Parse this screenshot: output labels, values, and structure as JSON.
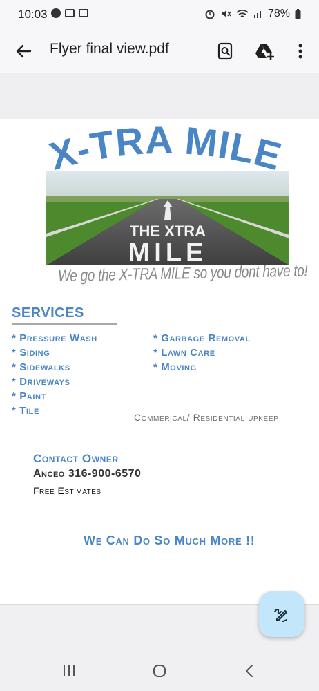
{
  "status_bar": {
    "time": "10:03",
    "battery": "78%"
  },
  "app_bar": {
    "title": "Flyer final view.pdf",
    "icons": [
      "back-arrow-icon",
      "search-document-icon",
      "add-to-drive-icon",
      "more-vert-icon"
    ]
  },
  "flyer": {
    "headline": "X-TRA MILE",
    "image_text_line1": "THE XTRA",
    "image_text_line2": "MILE",
    "tagline": "We go the X-TRA MILE so you dont have to!",
    "services_heading": "SERVICES",
    "services_left": [
      "* Pressure Wash",
      "* Siding",
      "* Sidewalks",
      "* Driveways",
      "* Paint",
      "* Tile"
    ],
    "services_right": [
      "* Garbage Removal",
      "* Lawn Care",
      "* Moving"
    ],
    "commercial": "Commerical/ Residential upkeep",
    "contact_heading": "Contact Owner",
    "contact_name_phone": "Anceo 316-900-6570",
    "free_estimates": "Free Estimates",
    "more": "We Can Do So Much More !!"
  },
  "fab": {
    "icon": "edit-pen-icon"
  },
  "nav_bar": {
    "icons": [
      "recent-apps-icon",
      "home-icon",
      "back-icon"
    ]
  },
  "colors": {
    "accent_blue": "#4a86c5",
    "fab_bg": "#c4e6fa"
  }
}
